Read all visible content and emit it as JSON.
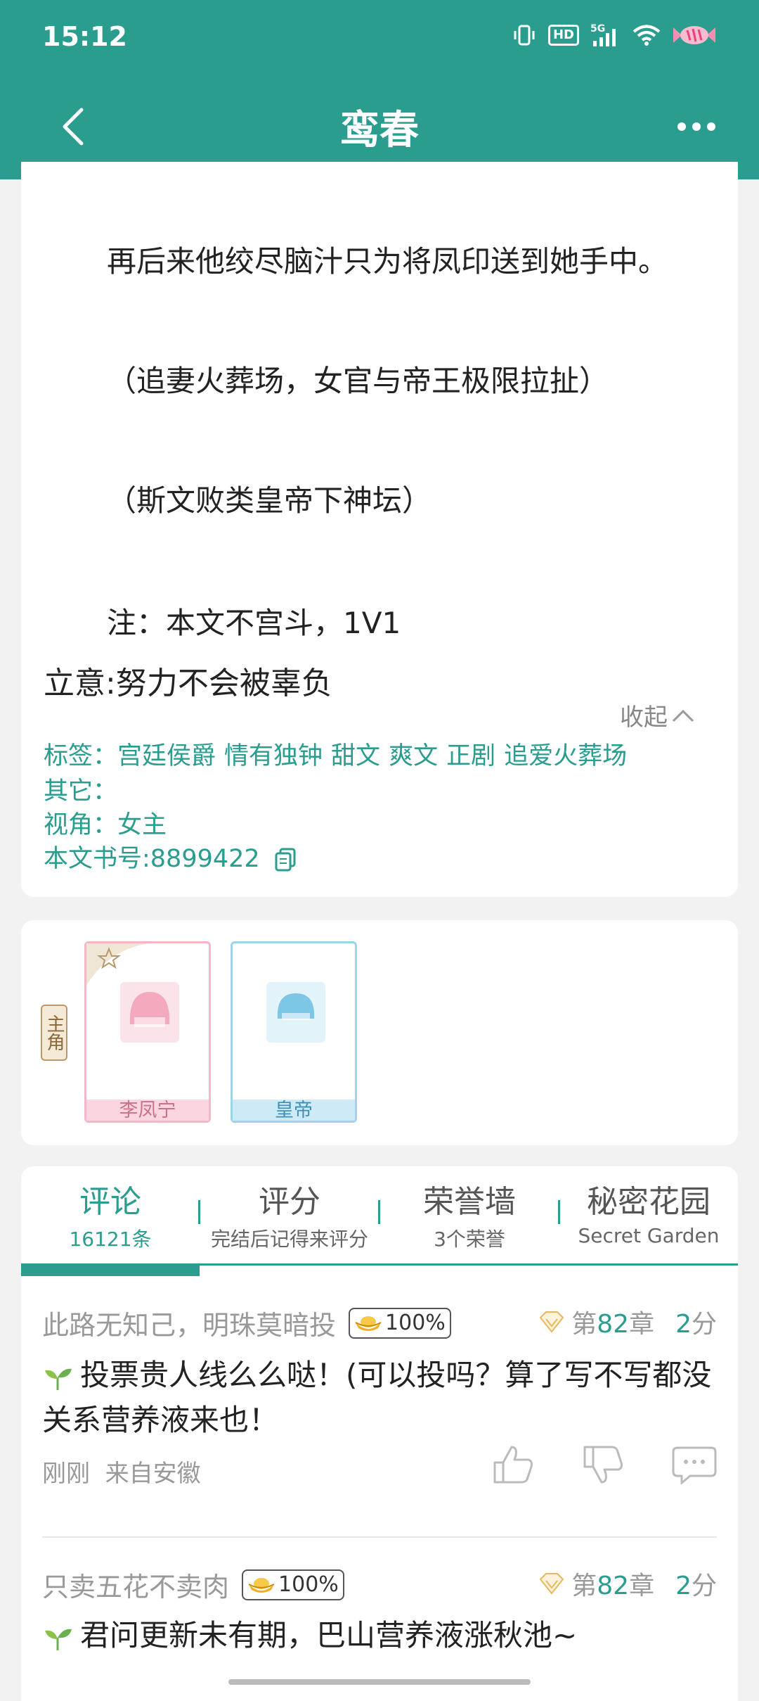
{
  "status_bar": {
    "time": "15:12",
    "network": "5G",
    "hd": "HD"
  },
  "nav": {
    "title": "鸾春"
  },
  "description": {
    "lines": [
      "再后来他绞尽脑汁只为将凤印送到她手中。",
      "（追妻火葬场，女官与帝王极限拉扯）",
      "（斯文败类皇帝下神坛）",
      "注：本文不宫斗，1V1"
    ],
    "intent": "立意:努力不会被辜负",
    "collapse_label": "收起",
    "tags_label": "标签：",
    "tags": [
      "宫廷侯爵",
      "情有独钟",
      "甜文",
      "爽文",
      "正剧",
      "追爱火葬场"
    ],
    "other": "其它：",
    "perspective": "视角：女主",
    "book_id": "本文书号:8899422"
  },
  "characters": {
    "lead_badge": "主角",
    "items": [
      {
        "name": "李凤宁"
      },
      {
        "name": "皇帝"
      }
    ]
  },
  "tabs": [
    {
      "label": "评论",
      "sub": "16121条"
    },
    {
      "label": "评分",
      "sub": "完结后记得来评分"
    },
    {
      "label": "荣誉墙",
      "sub": "3个荣誉"
    },
    {
      "label": "秘密花园",
      "sub": "Secret Garden"
    }
  ],
  "comments": [
    {
      "author": "此路无知己，明珠莫暗投",
      "badge": "100%",
      "chapter_prefix": "第",
      "chapter_num": "82",
      "chapter_suffix": "章",
      "score_num": "2",
      "score_unit": "分",
      "body": "投票贵人线么么哒！(可以投吗？算了写不写都没关系营养液来也！",
      "time": "刚刚",
      "location": "来自安徽"
    },
    {
      "author": "只卖五花不卖肉",
      "badge": "100%",
      "chapter_prefix": "第",
      "chapter_num": "82",
      "chapter_suffix": "章",
      "score_num": "2",
      "score_unit": "分",
      "body": "君问更新未有期，巴山营养液涨秋池~"
    }
  ],
  "colors": {
    "accent": "#2a9d8f",
    "pink": "#f4b7c8",
    "blue": "#9cd5ea"
  }
}
